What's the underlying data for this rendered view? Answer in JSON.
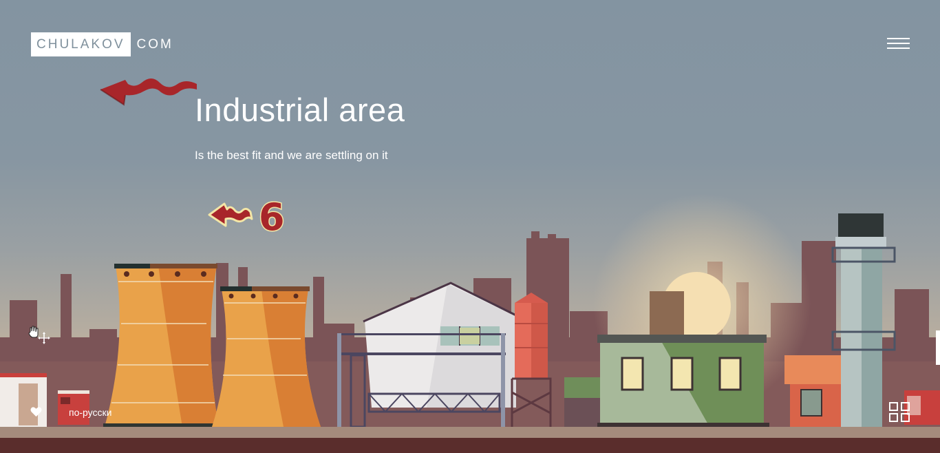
{
  "header": {
    "logo_main": "CHULAKOV",
    "logo_suffix": "COM"
  },
  "hero": {
    "title": "Industrial area",
    "subtitle": "Is the best fit and we are settling on it"
  },
  "annotation": {
    "number": "6"
  },
  "footer": {
    "language_link": "по-русски"
  },
  "colors": {
    "sky": "#8394a1",
    "silhouette": "#7a4f52",
    "cooling_tower": "#e0923a",
    "annotation_red": "#a8262a",
    "annotation_outline": "#f3e6a6"
  },
  "icons": {
    "menu": "hamburger-menu-icon",
    "heart": "heart-icon",
    "grid": "grid-view-icon",
    "cursor": "hand-cursor-icon"
  }
}
